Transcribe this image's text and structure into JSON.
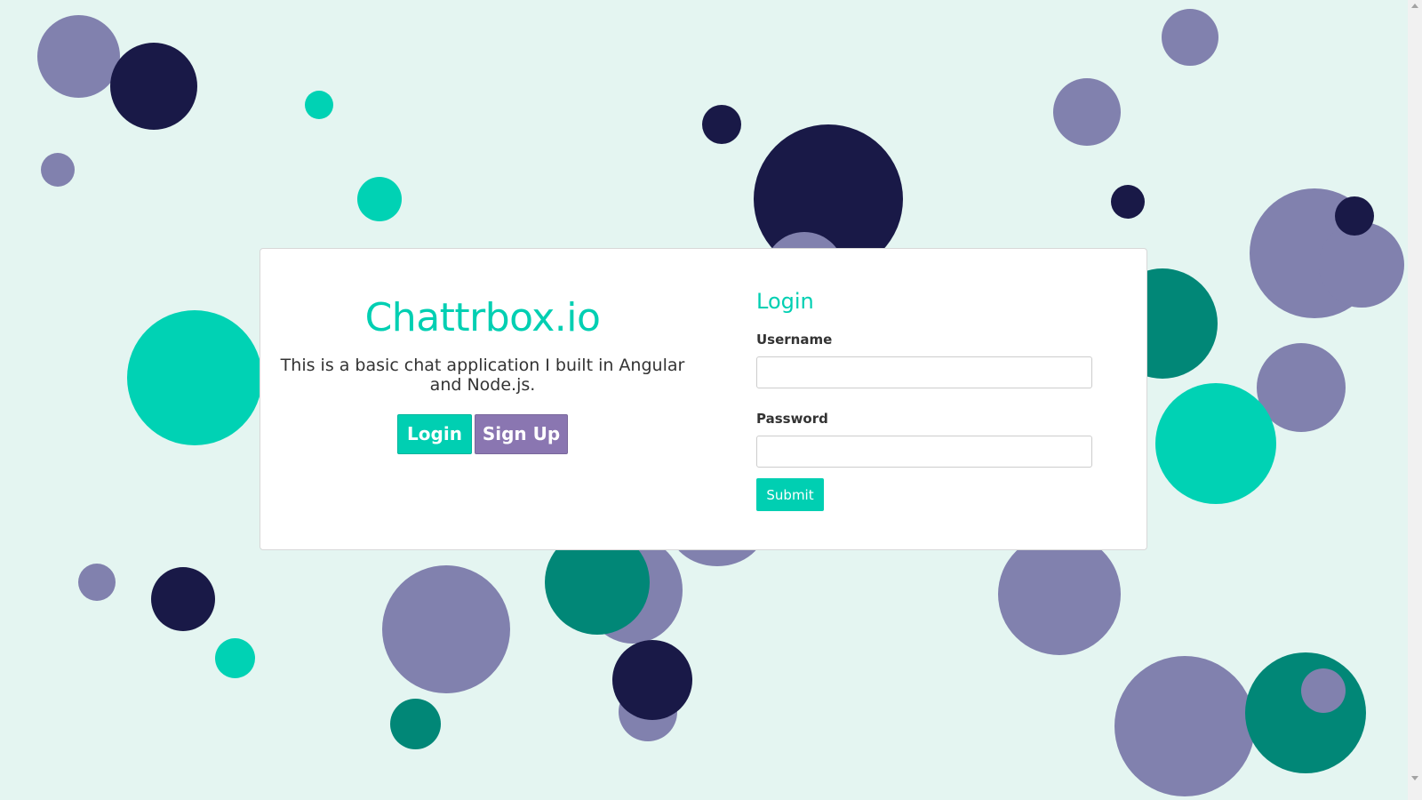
{
  "app": {
    "title": "Chattrbox.io",
    "description": "This is a basic chat application I built in Angular and Node.js.",
    "login_button": "Login",
    "signup_button": "Sign Up"
  },
  "login_form": {
    "title": "Login",
    "username_label": "Username",
    "username_value": "",
    "password_label": "Password",
    "password_value": "",
    "submit_label": "Submit"
  },
  "colors": {
    "accent_teal": "#00cfb2",
    "signup_purple": "#8a76b1",
    "background": "#e4f5f1",
    "bubble_purple": "#8181ae",
    "bubble_navy": "#191947",
    "bubble_teal": "#00d2b4",
    "bubble_green": "#018777"
  }
}
